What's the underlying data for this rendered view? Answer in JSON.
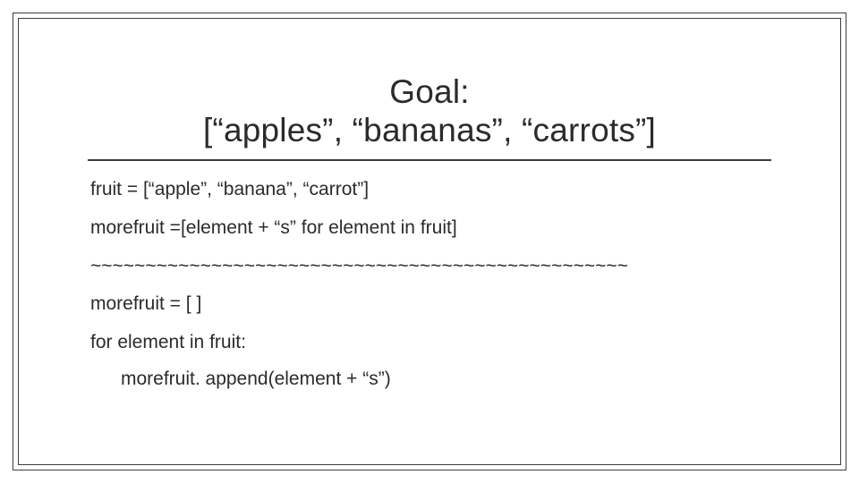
{
  "title": {
    "line1": "Goal:",
    "line2": "[“apples”, “bananas”, “carrots”]"
  },
  "code": {
    "l1": "fruit = [“apple”, “banana”, “carrot”]",
    "l2": "morefruit =[element + “s” for element in fruit]",
    "sep": "~~~~~~~~~~~~~~~~~~~~~~~~~~~~~~~~~~~~~~~~~~~~~~~~~",
    "l3": "morefruit = [ ]",
    "l4": "for element in fruit:",
    "l5": "morefruit. append(element + “s”)"
  }
}
